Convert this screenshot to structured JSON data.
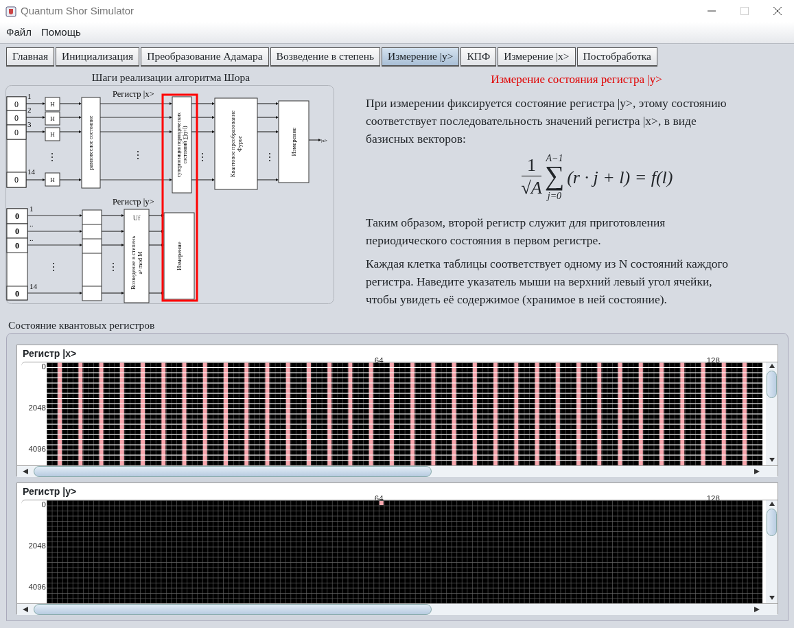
{
  "window": {
    "title": "Quantum Shor Simulator"
  },
  "menu": [
    "Файл",
    "Помощь"
  ],
  "tabs": [
    {
      "label": "Главная",
      "selected": false
    },
    {
      "label": "Инициализация",
      "selected": false
    },
    {
      "label": "Преобразование Адамара",
      "selected": false
    },
    {
      "label": "Возведение в степень",
      "selected": false
    },
    {
      "label": "Измерение |y>",
      "selected": true
    },
    {
      "label": "КПФ",
      "selected": false
    },
    {
      "label": "Измерение |x>",
      "selected": false
    },
    {
      "label": "Постобработка",
      "selected": false
    }
  ],
  "heading": "Измерение состояния регистра |y>",
  "diagram": {
    "title": "Шаги реализации алгоритма Шора",
    "register_x_label": "Регистр |x>",
    "register_y_label": "Регистр |y>",
    "x_inputs": [
      {
        "number": "1",
        "value": "0"
      },
      {
        "number": "2",
        "value": "0"
      },
      {
        "number": "3",
        "value": "0"
      },
      {
        "number": "14",
        "value": "0"
      }
    ],
    "y_inputs": [
      {
        "number": "1",
        "value": "0"
      },
      {
        "number": "..",
        "value": "0"
      },
      {
        "number": "..",
        "value": "0"
      },
      {
        "number": "14",
        "value": "0"
      }
    ],
    "gates": [
      "H",
      "H",
      "H",
      "H"
    ],
    "equal_state": "равновесное состояние",
    "superposition": [
      "суперпозиция периодических",
      "состояний ∑|rj+l)"
    ],
    "qft": [
      "Квантовое преобразование",
      "Фурье"
    ],
    "measure_x": "Измерение",
    "output": "|x>",
    "uf": "Uf",
    "power": [
      "Возведение в степень",
      "aˣ mod M"
    ],
    "measure_y": "Измерение",
    "highlighted": true
  },
  "paragraphs": [
    "При измерении фиксируется состояние регистра |y>, этому состоянию соответствует последовательность значений регистра |x>, в виде базисных векторов:",
    "Таким образом, второй регистр служит для приготовления периодического состояния в первом регистре.",
    "Каждая клетка таблицы соответствует одному из N состояний каждого регистра. Наведите указатель мыши на верхний левый угол ячейки, чтобы увидеть её содержимое (хранимое в ней состояние)."
  ],
  "formula": {
    "numerator": "1",
    "denominator": "√A",
    "sum_upper": "A−1",
    "sum_sign": "∑",
    "sum_lower": "j=0",
    "body": "(r · j + l) = f(l)"
  },
  "registers_panel": {
    "title": "Состояние квантовых регистров",
    "registers": [
      {
        "label": "Регистр |x>",
        "column_labels": [
          "64",
          "128"
        ],
        "row_labels": [
          "0",
          "2048",
          "4096"
        ],
        "kind": "periodic"
      },
      {
        "label": "Регистр |y>",
        "column_labels": [
          "64",
          "128"
        ],
        "row_labels": [
          "0",
          "2048",
          "4096"
        ],
        "kind": "single"
      }
    ]
  }
}
